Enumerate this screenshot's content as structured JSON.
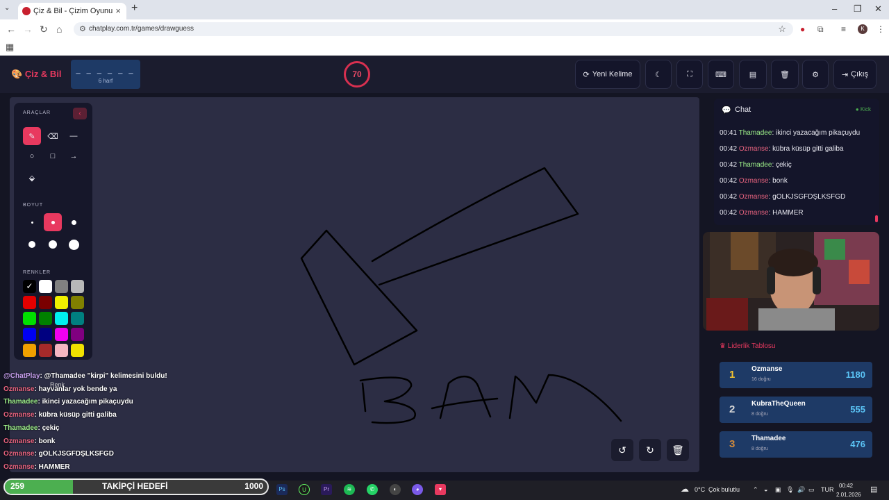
{
  "browser": {
    "tab_title": "Çiz & Bil - Çizim Oyunu",
    "url": "chatplay.com.tr/games/drawguess",
    "profile_initial": "K"
  },
  "header": {
    "logo": "Çiz & Bil",
    "word_mask": "_ _ _ _ _ _",
    "word_hint": "6 harf",
    "timer": "70",
    "new_word": "Yeni Kelime",
    "exit": "Çıkış"
  },
  "tools": {
    "tools_label": "ARAÇLAR",
    "size_label": "BOYUT",
    "colors_label": "RENKLER",
    "custom_color_label": "Renk",
    "colors": [
      "#000000",
      "#ffffff",
      "#808080",
      "#b8b8b8",
      "#e30000",
      "#7a0000",
      "#f0f000",
      "#808000",
      "#00e000",
      "#008000",
      "#00f0f0",
      "#008080",
      "#0000f0",
      "#000080",
      "#f000f0",
      "#800080",
      "#f0a000",
      "#a52a2a",
      "#f4b6c2",
      "#f0e000"
    ]
  },
  "canvas": {
    "scribble": "BAM"
  },
  "chat": {
    "title": "Chat",
    "kick": "Kick",
    "messages": [
      {
        "time": "00:41",
        "user": "Thamadee",
        "type": 1,
        "text": "ikinci yazacağım pikaçuydu"
      },
      {
        "time": "00:42",
        "user": "Ozmanse",
        "type": 2,
        "text": "kübra küsüp gitti galiba"
      },
      {
        "time": "00:42",
        "user": "Thamadee",
        "type": 1,
        "text": "çekiç"
      },
      {
        "time": "00:42",
        "user": "Ozmanse",
        "type": 2,
        "text": "bonk"
      },
      {
        "time": "00:42",
        "user": "Ozmanse",
        "type": 2,
        "text": "gOLKJSGFDŞLKSFGD"
      },
      {
        "time": "00:42",
        "user": "Ozmanse",
        "type": 2,
        "text": "HAMMER"
      }
    ]
  },
  "leaderboard": {
    "title": "Liderlik Tablosu",
    "rows": [
      {
        "rank": "1",
        "name": "Ozmanse",
        "guesses": "16 doğru",
        "points": "1180",
        "rank_color": "#f4c430"
      },
      {
        "rank": "2",
        "name": "KubraTheQueen",
        "guesses": "8 doğru",
        "points": "555",
        "rank_color": "#d8d8d8"
      },
      {
        "rank": "3",
        "name": "Thamadee",
        "guesses": "8 doğru",
        "points": "476",
        "rank_color": "#d08a3c"
      }
    ]
  },
  "overlay_chat": [
    {
      "user": "@ChatPlay",
      "text": ": @Thamadee \"kirpi\" kelimesini buldu!",
      "color": "#c8a0f0"
    },
    {
      "user": "Ozmanse",
      "text": ": hayvanlar yok bende ya",
      "color": "#e8637f"
    },
    {
      "user": "Thamadee",
      "text": ": ikinci yazacağım pikaçuydu",
      "color": "#9ef08a"
    },
    {
      "user": "Ozmanse",
      "text": ": kübra küsüp gitti galiba",
      "color": "#e8637f"
    },
    {
      "user": "Thamadee",
      "text": ": çekiç",
      "color": "#9ef08a"
    },
    {
      "user": "Ozmanse",
      "text": ": bonk",
      "color": "#e8637f"
    },
    {
      "user": "Ozmanse",
      "text": ": gOLKJSGFDŞLKSFGD",
      "color": "#e8637f"
    },
    {
      "user": "Ozmanse",
      "text": ": HAMMER",
      "color": "#e8637f"
    }
  ],
  "follower_goal": {
    "current": "259",
    "label": "TAKİPÇİ HEDEFİ",
    "goal": "1000",
    "progress": 0.259
  },
  "taskbar": {
    "weather_temp": "0°C",
    "weather_text": "Çok bulutlu",
    "lang": "TUR",
    "time": "00:42",
    "date": "2.01.2026"
  }
}
